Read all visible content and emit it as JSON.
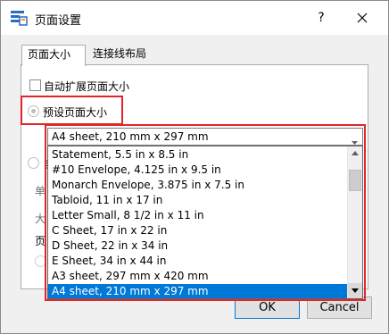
{
  "window": {
    "title": "页面设置",
    "help_label": "?",
    "close_icon": "close-icon",
    "app_icon": "page-setup-app-icon",
    "accent_color": "#e0262b"
  },
  "tabs": [
    {
      "label": "页面大小",
      "active": true
    },
    {
      "label": "连接线布局",
      "active": false
    }
  ],
  "page_size": {
    "auto_expand_label": "自动扩展页面大小",
    "auto_expand_checked": false,
    "preset_label": "预设页面大小",
    "preset_selected": true,
    "combo_value": "A4 sheet, 210 mm x 297 mm",
    "options": [
      "Statement, 5.5 in x 8.5 in",
      "#10 Envelope, 4.125 in x 9.5 in",
      "Monarch Envelope, 3.875 in x 7.5 in",
      "Tabloid, 11 in x 17 in",
      "Letter Small, 8 1/2 in x 11 in",
      "C Sheet, 17 in x 22 in",
      "D Sheet, 22 in x 34 in",
      "E Sheet, 34 in x 44 in",
      "A3 sheet, 297 mm x 420 mm",
      "A4 sheet, 210 mm x 297 mm"
    ],
    "selected_option": "A4 sheet, 210 mm x 297 mm",
    "occluded_labels": {
      "custom": "自",
      "unit": "单",
      "size": "大",
      "orientation": "页"
    }
  },
  "buttons": {
    "ok": "OK",
    "cancel": "Cancel"
  }
}
